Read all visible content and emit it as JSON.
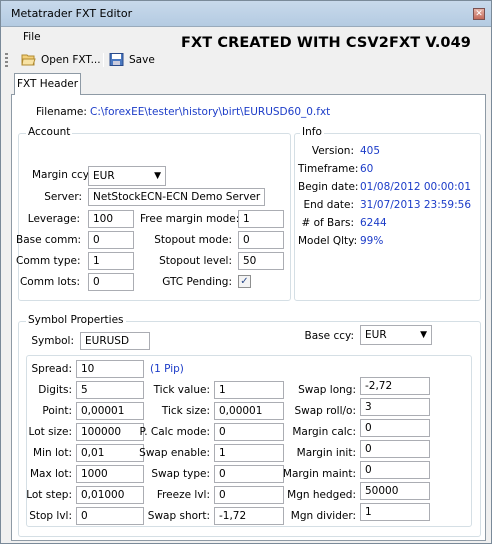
{
  "window": {
    "title": "Metatrader FXT Editor",
    "close_glyph": "✕"
  },
  "menu": {
    "file": "File"
  },
  "banner": "FXT CREATED WITH CSV2FXT V.049",
  "toolbar": {
    "open": "Open FXT...",
    "save": "Save"
  },
  "tab": "FXT Header",
  "filename": {
    "label": "Filename:",
    "value": "C:\\forexEE\\tester\\history\\birt\\EURUSD60_0.fxt"
  },
  "account": {
    "title": "Account",
    "margin_ccy": {
      "label": "Margin ccy:",
      "value": "EUR"
    },
    "server": {
      "label": "Server:",
      "value": "NetStockECN-ECN Demo Server"
    },
    "leverage": {
      "label": "Leverage:",
      "value": "100"
    },
    "free_margin_mode": {
      "label": "Free margin mode:",
      "value": "1"
    },
    "base_comm": {
      "label": "Base comm:",
      "value": "0"
    },
    "stopout_mode": {
      "label": "Stopout mode:",
      "value": "0"
    },
    "comm_type": {
      "label": "Comm type:",
      "value": "1"
    },
    "stopout_level": {
      "label": "Stopout level:",
      "value": "50"
    },
    "comm_lots": {
      "label": "Comm lots:",
      "value": "0"
    },
    "gtc_pending": {
      "label": "GTC Pending:",
      "checked": true
    }
  },
  "info": {
    "title": "Info",
    "version": {
      "label": "Version:",
      "value": "405"
    },
    "timeframe": {
      "label": "Timeframe:",
      "value": "60"
    },
    "begin_date": {
      "label": "Begin date:",
      "value": "01/08/2012 00:00:01"
    },
    "end_date": {
      "label": "End date:",
      "value": "31/07/2013 23:59:56"
    },
    "bars": {
      "label": "# of Bars:",
      "value": "6244"
    },
    "model_qlty": {
      "label": "Model Qlty:",
      "value": "99%"
    }
  },
  "symbol": {
    "title": "Symbol Properties",
    "symbol": {
      "label": "Symbol:",
      "value": "EURUSD"
    },
    "base_ccy": {
      "label": "Base ccy:",
      "value": "EUR"
    },
    "spread": {
      "label": "Spread:",
      "value": "10",
      "note": "(1 Pip)"
    },
    "digits": {
      "label": "Digits:",
      "value": "5"
    },
    "point": {
      "label": "Point:",
      "value": "0,00001"
    },
    "lot_size": {
      "label": "Lot size:",
      "value": "100000"
    },
    "min_lot": {
      "label": "Min lot:",
      "value": "0,01"
    },
    "max_lot": {
      "label": "Max lot:",
      "value": "1000"
    },
    "lot_step": {
      "label": "Lot step:",
      "value": "0,01000"
    },
    "stop_lvl": {
      "label": "Stop lvl:",
      "value": "0"
    },
    "tick_value": {
      "label": "Tick value:",
      "value": "1"
    },
    "tick_size": {
      "label": "Tick size:",
      "value": "0,00001"
    },
    "p_calc_mode": {
      "label": "P. Calc mode:",
      "value": "0"
    },
    "swap_enable": {
      "label": "Swap enable:",
      "value": "1"
    },
    "swap_type": {
      "label": "Swap type:",
      "value": "0"
    },
    "freeze_lvl": {
      "label": "Freeze lvl:",
      "value": "0"
    },
    "swap_short": {
      "label": "Swap short:",
      "value": "-1,72"
    },
    "swap_long": {
      "label": "Swap long:",
      "value": "-2,72"
    },
    "swap_rollo": {
      "label": "Swap roll/o:",
      "value": "3"
    },
    "margin_calc": {
      "label": "Margin calc:",
      "value": "0"
    },
    "margin_init": {
      "label": "Margin init:",
      "value": "0"
    },
    "margin_maint": {
      "label": "Margin maint:",
      "value": "0"
    },
    "mgn_hedged": {
      "label": "Mgn hedged:",
      "value": "50000"
    },
    "mgn_divider": {
      "label": "Mgn divider:",
      "value": "1"
    }
  },
  "icons": {
    "open": "folder-open-icon",
    "save": "floppy-disk-icon",
    "dropdown": "chevron-down-icon",
    "close": "close-icon",
    "check": "checkmark-icon"
  }
}
